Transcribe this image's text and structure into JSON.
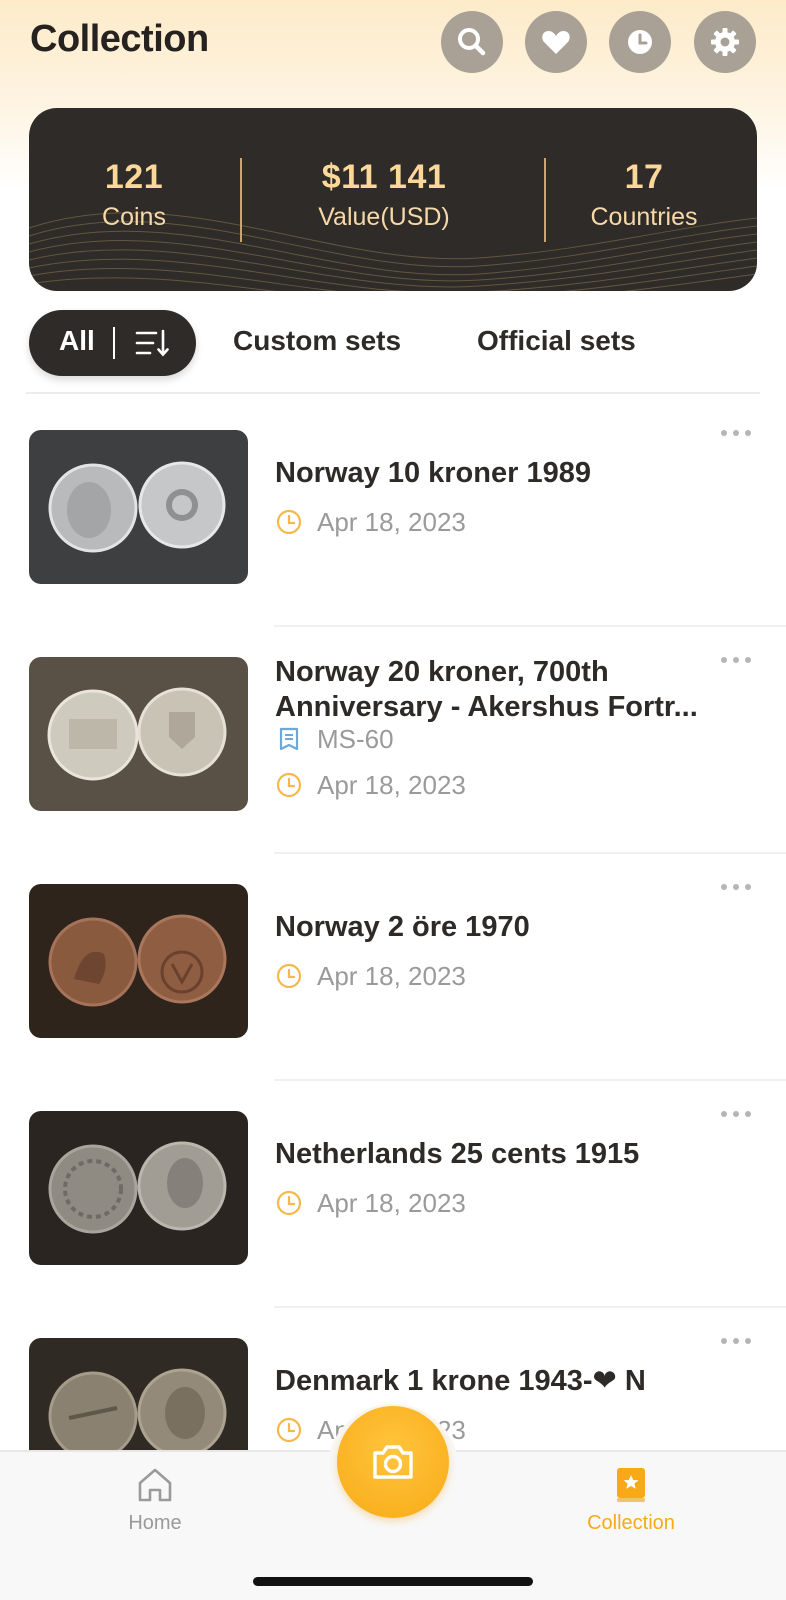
{
  "header": {
    "title": "Collection",
    "actions": [
      {
        "name": "search-icon"
      },
      {
        "name": "heart-icon"
      },
      {
        "name": "clock-icon"
      },
      {
        "name": "gear-icon"
      }
    ]
  },
  "stats": {
    "coins_value": "121",
    "coins_label": "Coins",
    "value_value": "$11 141",
    "value_label": "Value(USD)",
    "countries_value": "17",
    "countries_label": "Countries"
  },
  "filters": {
    "all_label": "All",
    "custom_label": "Custom sets",
    "official_label": "Official sets"
  },
  "items": [
    {
      "title": "Norway 10 kroner 1989",
      "grade": "",
      "date": "Apr 18, 2023"
    },
    {
      "title": "Norway 20 kroner, 700th Anniversary - Akershus Fortr...",
      "grade": "MS-60",
      "date": "Apr 18, 2023"
    },
    {
      "title": "Norway 2 öre 1970",
      "grade": "",
      "date": "Apr 18, 2023"
    },
    {
      "title": "Netherlands 25 cents 1915",
      "grade": "",
      "date": "Apr 18, 2023"
    },
    {
      "title": "Denmark 1 krone 1943-❤ N",
      "grade": "",
      "date": "Apr 18, 2023"
    }
  ],
  "nav": {
    "home_label": "Home",
    "collection_label": "Collection",
    "active": "Collection"
  },
  "colors": {
    "accent": "#f8aa16",
    "card_bg": "#2f2b29",
    "stat_text": "#fbd79a",
    "inactive_nav": "#9a9a9a"
  }
}
